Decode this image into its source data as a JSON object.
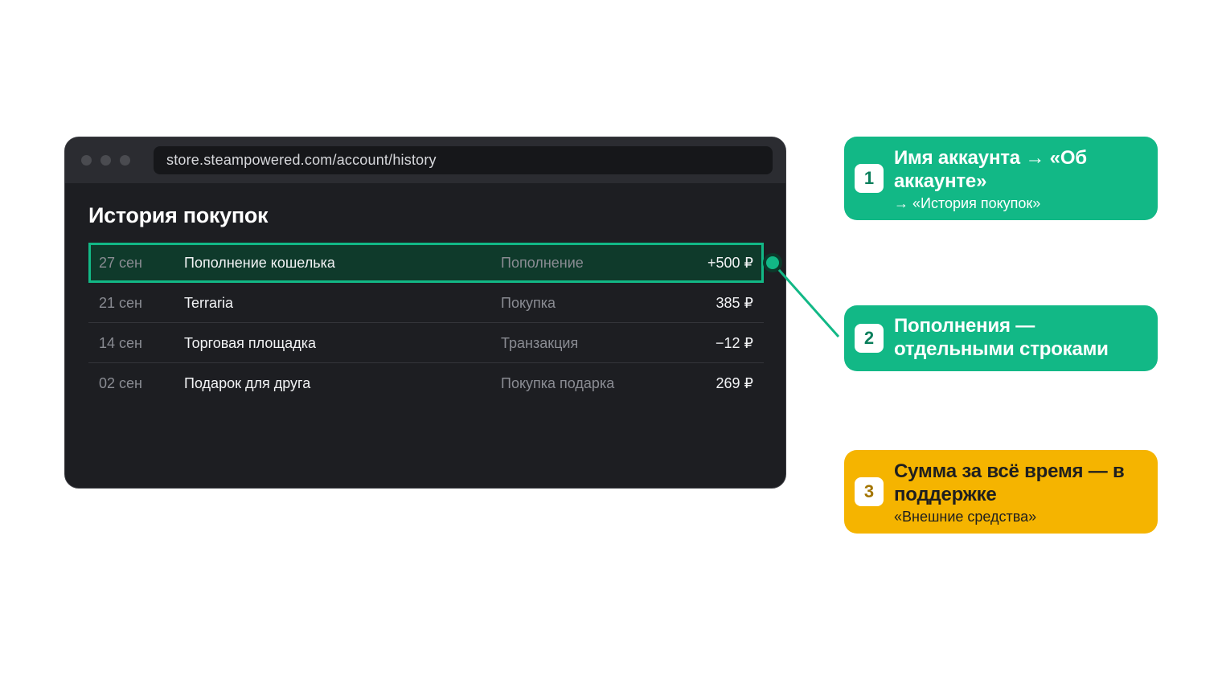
{
  "browser": {
    "url": "store.steampowered.com/account/history"
  },
  "page": {
    "title": "История покупок"
  },
  "history": {
    "rows": [
      {
        "date": "27 сен",
        "item": "Пополнение кошелька",
        "type": "Пополнение",
        "amount": "+500 ₽",
        "highlighted": true
      },
      {
        "date": "21 сен",
        "item": "Terraria",
        "type": "Покупка",
        "amount": "385 ₽"
      },
      {
        "date": "14 сен",
        "item": "Торговая площадка",
        "type": "Транзакция",
        "amount": "−12 ₽"
      },
      {
        "date": "02 сен",
        "item": "Подарок для друга",
        "type": "Покупка подарка",
        "amount": "269 ₽"
      }
    ]
  },
  "callouts": [
    {
      "number": "1",
      "title": "Имя аккаунта → «Об аккаунте»",
      "subtitle": "→ «История покупок»",
      "color": "#12b886"
    },
    {
      "number": "2",
      "title": "Пополнения — отдельными строками",
      "subtitle": "",
      "color": "#12b886"
    },
    {
      "number": "3",
      "title": "Сумма за всё время — в поддержке",
      "subtitle": "«Внешние средства»",
      "color": "#f5b400"
    }
  ],
  "colors": {
    "accent_green": "#12b886",
    "accent_yellow": "#f5b400",
    "window_bg": "#1d1e22",
    "highlight_row_bg": "#0f3a2b"
  }
}
